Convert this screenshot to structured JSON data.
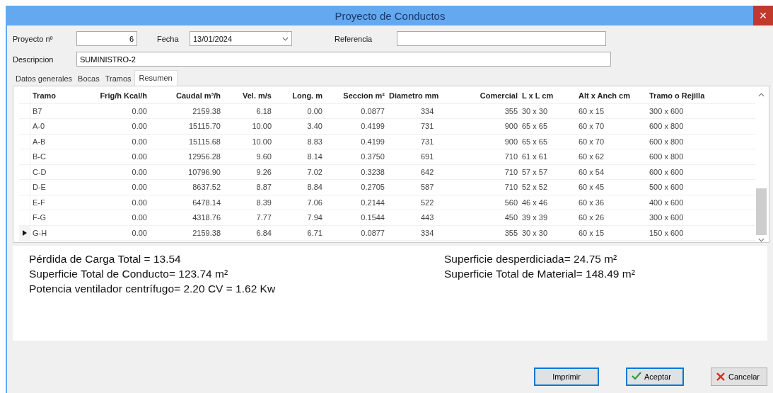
{
  "window": {
    "title": "Proyecto de Conductos",
    "close": "×"
  },
  "form": {
    "project_label": "Proyecto nº",
    "project_value": "6",
    "date_label": "Fecha",
    "date_value": "13/01/2024",
    "reference_label": "Referencia",
    "description_label": "Descripcion",
    "description_value": "SUMINISTRO-2"
  },
  "tabs": [
    {
      "label": "Datos generales",
      "selected": false
    },
    {
      "label": "Bocas",
      "selected": false
    },
    {
      "label": "Tramos",
      "selected": false
    },
    {
      "label": "Resumen",
      "selected": true
    }
  ],
  "table": {
    "columns": [
      "Tramo",
      "Frig/h Kcal/h",
      "Caudal m³/h",
      "Vel. m/s",
      "Long. m",
      "Seccion m²",
      "Diametro mm",
      "Comercial",
      "L x L cm",
      "Alt x Anch cm",
      "Tramo o Rejilla"
    ],
    "rows": [
      {
        "selected": false,
        "cells": [
          "B7",
          "0.00",
          "2159.38",
          "6.18",
          "0.00",
          "0.0877",
          "334",
          "355",
          "30 x 30",
          "60 x 15",
          "300 x 600"
        ]
      },
      {
        "selected": false,
        "cells": [
          "A-0",
          "0.00",
          "15115.70",
          "10.00",
          "3.40",
          "0.4199",
          "731",
          "900",
          "65 x 65",
          "60 x 70",
          "600 x 800"
        ]
      },
      {
        "selected": false,
        "cells": [
          "A-B",
          "0.00",
          "15115.68",
          "10.00",
          "8.83",
          "0.4199",
          "731",
          "900",
          "65 x 65",
          "60 x 70",
          "600 x 800"
        ]
      },
      {
        "selected": false,
        "cells": [
          "B-C",
          "0.00",
          "12956.28",
          "9.60",
          "8.14",
          "0.3750",
          "691",
          "710",
          "61 x 61",
          "60 x 62",
          "600 x 800"
        ]
      },
      {
        "selected": false,
        "cells": [
          "C-D",
          "0.00",
          "10796.90",
          "9.26",
          "7.02",
          "0.3238",
          "642",
          "710",
          "57 x 57",
          "60 x 54",
          "600 x 600"
        ]
      },
      {
        "selected": false,
        "cells": [
          "D-E",
          "0.00",
          "8637.52",
          "8.87",
          "8.84",
          "0.2705",
          "587",
          "710",
          "52 x 52",
          "60 x 45",
          "500 x 600"
        ]
      },
      {
        "selected": false,
        "cells": [
          "E-F",
          "0.00",
          "6478.14",
          "8.39",
          "7.06",
          "0.2144",
          "522",
          "560",
          "46 x 46",
          "60 x 36",
          "400 x 600"
        ]
      },
      {
        "selected": false,
        "cells": [
          "F-G",
          "0.00",
          "4318.76",
          "7.77",
          "7.94",
          "0.1544",
          "443",
          "450",
          "39 x 39",
          "60 x 26",
          "300 x 600"
        ]
      },
      {
        "selected": true,
        "cells": [
          "G-H",
          "0.00",
          "2159.38",
          "6.84",
          "6.71",
          "0.0877",
          "334",
          "355",
          "30 x 30",
          "60 x 15",
          "150 x 600"
        ]
      }
    ]
  },
  "summary": {
    "left": [
      "Pérdida de Carga Total = 13.54",
      "Superficie Total de Conducto= 123.74 m²",
      "Potencia ventilador centrífugo= 2.20 CV = 1.62 Kw"
    ],
    "right": [
      "Superficie desperdiciada= 24.75 m²",
      "Superficie Total de Material= 148.49 m²"
    ]
  },
  "buttons": [
    {
      "kind": "plain",
      "label": "Imprimir"
    },
    {
      "kind": "ok",
      "label": "Aceptar"
    },
    {
      "kind": "cancel",
      "label": "Cancelar"
    }
  ]
}
